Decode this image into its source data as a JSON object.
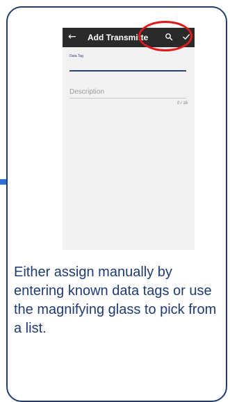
{
  "app_bar": {
    "title": "Add Transmitte",
    "back_icon": "arrow-left-icon",
    "search_icon": "search-icon",
    "confirm_icon": "check-icon"
  },
  "form": {
    "data_tag_label": "Data Tag",
    "description_placeholder": "Description",
    "counter": "0 / 16"
  },
  "caption": "Either assign manually by entering known data tags or use the magnifying glass to pick from a list.",
  "colors": {
    "frame_border": "#1f3b73",
    "app_bar": "#2a2a2a",
    "accent": "#2e3f86",
    "highlight": "#e01a1a",
    "caption_text": "#1f3b73"
  }
}
